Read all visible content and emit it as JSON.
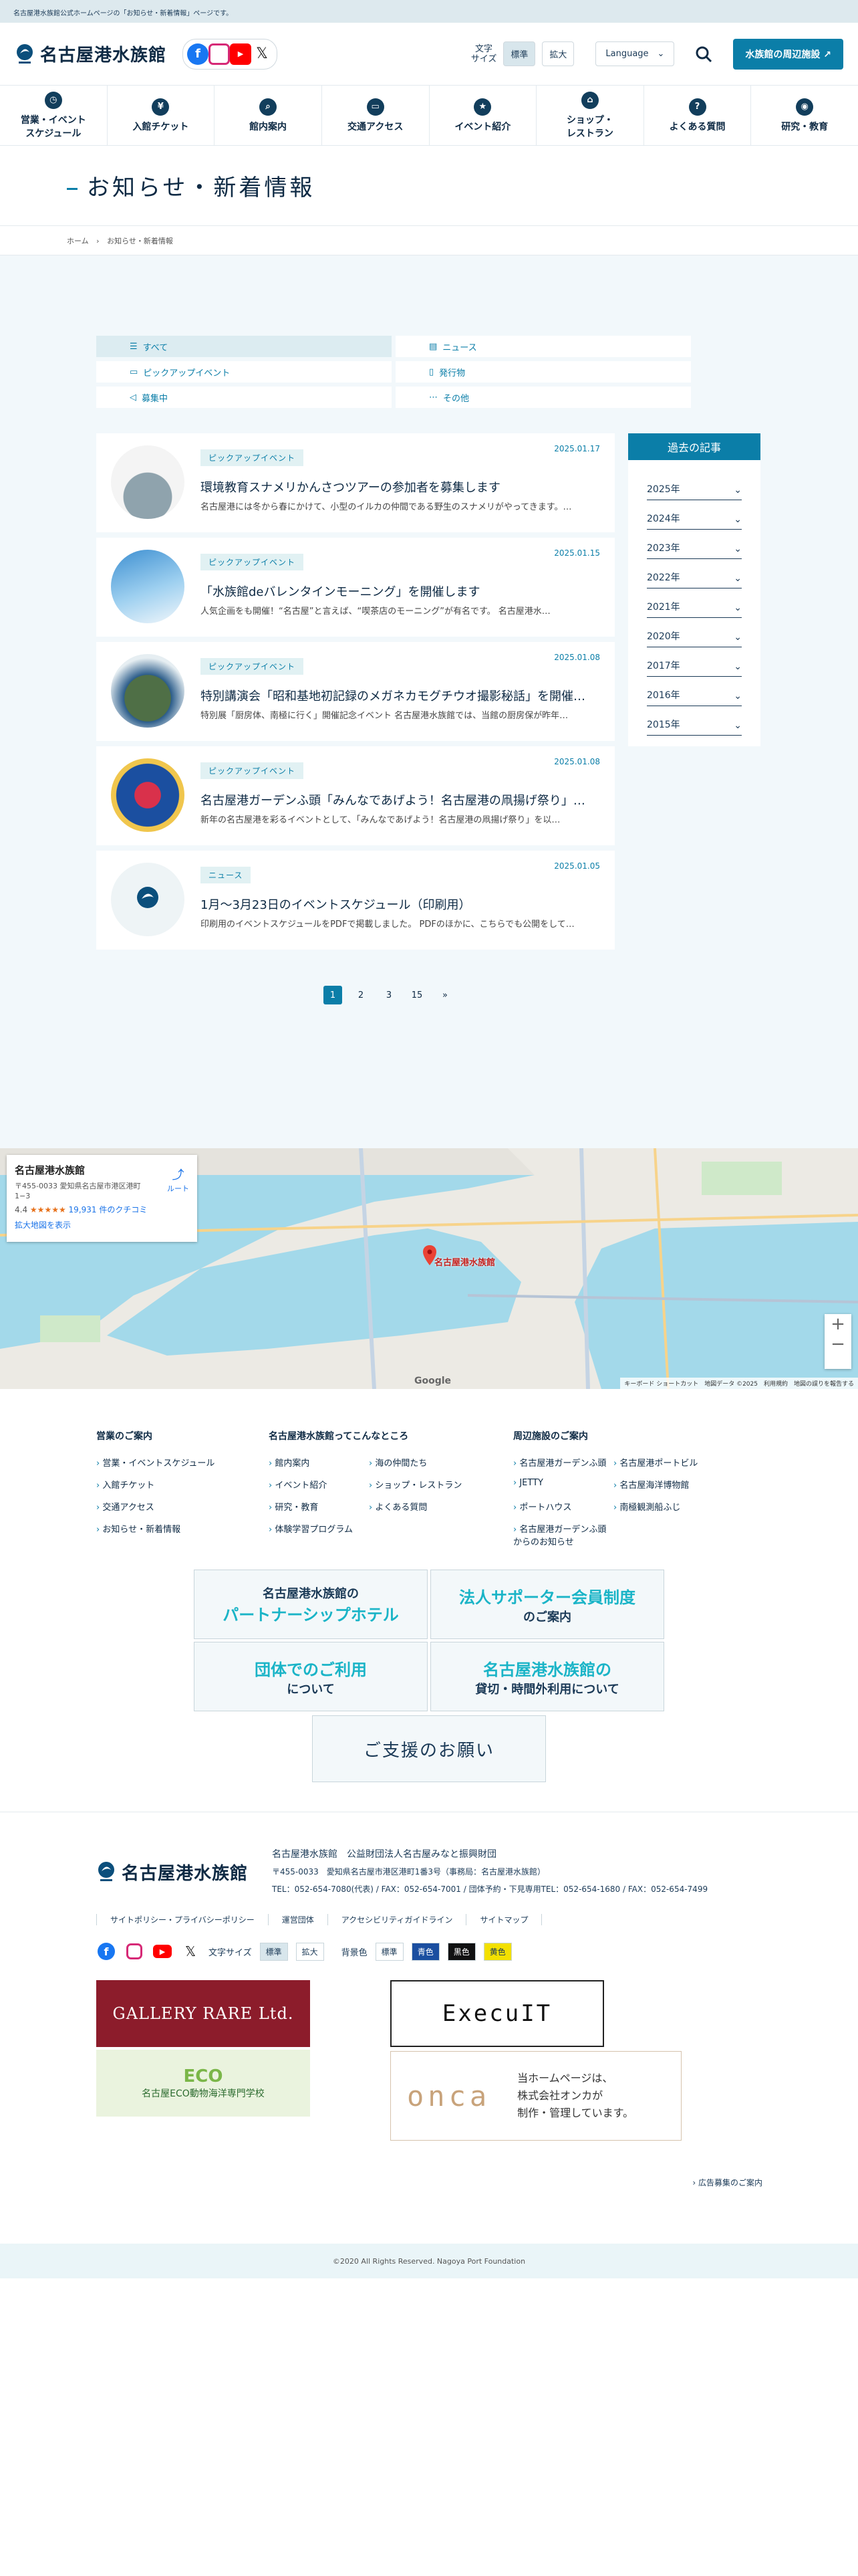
{
  "topbar": {
    "text": "名古屋港水族館公式ホームページの「お知らせ・新着情報」ページです。"
  },
  "header": {
    "logo_text": "名古屋港水族館",
    "font_size_label_1": "文字",
    "font_size_label_2": "サイズ",
    "font_size_standard": "標準",
    "font_size_large": "拡大",
    "language": "Language",
    "nearby_button": "水族館の周辺施設"
  },
  "gnav": [
    {
      "label1": "営業・イベント",
      "label2": "スケジュール",
      "icon": "clock-icon"
    },
    {
      "label1": "入館チケット",
      "label2": "",
      "icon": "ticket-icon"
    },
    {
      "label1": "館内案内",
      "label2": "",
      "icon": "map-icon"
    },
    {
      "label1": "交通アクセス",
      "label2": "",
      "icon": "bus-icon"
    },
    {
      "label1": "イベント紹介",
      "label2": "",
      "icon": "event-icon"
    },
    {
      "label1": "ショップ・",
      "label2": "レストラン",
      "icon": "shop-icon"
    },
    {
      "label1": "よくある質問",
      "label2": "",
      "icon": "question-icon"
    },
    {
      "label1": "研究・教育",
      "label2": "",
      "icon": "research-icon"
    }
  ],
  "page_title": "お知らせ・新着情報",
  "breadcrumb": {
    "home": "ホーム",
    "current": "お知らせ・新着情報"
  },
  "filters": [
    {
      "label": "すべて",
      "icon": "☰"
    },
    {
      "label": "ニュース",
      "icon": "▤"
    },
    {
      "label": "ピックアップイベント",
      "icon": "▭"
    },
    {
      "label": "発行物",
      "icon": "▯"
    },
    {
      "label": "募集中",
      "icon": "◁"
    },
    {
      "label": "その他",
      "icon": "⋯"
    }
  ],
  "articles": [
    {
      "tag": "ピックアップイベント",
      "date": "2025.01.17",
      "title": "環境教育スナメリかんさつツアーの参加者を募集します",
      "excerpt": "名古屋港には冬から春にかけて、小型のイルカの仲間である野生のスナメリがやってきます。…"
    },
    {
      "tag": "ピックアップイベント",
      "date": "2025.01.15",
      "title": "「水族館deバレンタインモーニング」を開催します",
      "excerpt": "人気企画をも開催！“名古屋”と言えば、“喫茶店のモーニング”が有名です。 名古屋港水…"
    },
    {
      "tag": "ピックアップイベント",
      "date": "2025.01.08",
      "title": "特別講演会「昭和基地初記録のメガネカモグチウオ撮影秘話」を開催…",
      "excerpt": "特別展「厨房体、南極に行く」開催記念イベント 名古屋港水族館では、当館の厨房保が昨年…"
    },
    {
      "tag": "ピックアップイベント",
      "date": "2025.01.08",
      "title": "名古屋港ガーデンふ頭「みんなであげよう！名古屋港の凧揚げ祭り」…",
      "excerpt": "新年の名古屋港を彩るイベントとして、「みんなであげよう！名古屋港の凧揚げ祭り」を以…"
    },
    {
      "tag": "ニュース",
      "date": "2025.01.05",
      "title": "1月〜3月23日のイベントスケジュール（印刷用）",
      "excerpt": "印刷用のイベントスケジュールをPDFで掲載しました。 PDFのほかに、こちらでも公開をして…"
    }
  ],
  "archive": {
    "title": "過去の記事",
    "years": [
      "2025年",
      "2024年",
      "2023年",
      "2022年",
      "2021年",
      "2020年",
      "2017年",
      "2016年",
      "2015年"
    ]
  },
  "pager": [
    "1",
    "2",
    "3",
    "15",
    "»"
  ],
  "map": {
    "place": "名古屋港水族館",
    "address": "〒455-0033 愛知県名古屋市港区港町 1−3",
    "rating": "4.4",
    "stars": "★★★★★",
    "reviews": "19,931 件のクチコミ",
    "expand": "拡大地図を表示",
    "route": "ルート",
    "pin_label": "名古屋港水族館",
    "footer": "キーボード ショートカット　地図データ ©2025　利用規約　地図の誤りを報告する",
    "google": "Google"
  },
  "footer_nav": [
    {
      "title": "営業のご案内",
      "items": [
        "営業・イベントスケジュール",
        "入館チケット",
        "交通アクセス",
        "お知らせ・新着情報"
      ]
    },
    {
      "title": "名古屋港水族館ってこんなところ",
      "items": [
        "館内案内",
        "海の仲間たち",
        "イベント紹介",
        "ショップ・レストラン",
        "研究・教育",
        "よくある質問",
        "体験学習プログラム"
      ]
    },
    {
      "title": "周辺施設のご案内",
      "items": [
        "名古屋港ガーデンふ頭",
        "名古屋港ポートビル",
        "JETTY",
        "名古屋海洋博物館",
        "ポートハウス",
        "南極観測船ふじ",
        "名古屋港ガーデンふ頭からのお知らせ"
      ]
    }
  ],
  "banners": [
    {
      "big": "名古屋港水族館の",
      "sub": "パートナーシップホテル"
    },
    {
      "big": "法人サポーター会員制度",
      "sub": "のご案内"
    },
    {
      "big": "団体でのご利用",
      "sub": "について"
    },
    {
      "big": "名古屋港水族館の",
      "sub": "貸切・時間外利用について"
    }
  ],
  "support": "ご支援のお願い",
  "footer": {
    "logo_text": "名古屋港水族館",
    "org": "名古屋港水族館　公益財団法人名古屋みなと振興財団",
    "address": "〒455-0033　愛知県名古屋市港区港町1番3号（事務局：名古屋港水族館）",
    "tel": "TEL：052-654-7080(代表) / FAX：052-654-7001 / 団体予約・下見専用TEL：052-654-1680 / FAX：052-654-7499",
    "links": [
      "サイトポリシー・プライバシーポリシー",
      "運営団体",
      "アクセシビリティガイドライン",
      "サイトマップ"
    ],
    "font_size": "文字サイズ",
    "standard": "標準",
    "large": "拡大",
    "bg_color": "背景色",
    "bg_standard": "標準",
    "bg_blue": "青色",
    "bg_black": "黒色",
    "bg_yellow": "黄色"
  },
  "ads": {
    "gallery": "GALLERY RARE Ltd.",
    "eco": "名古屋ECO動物海洋専門学校",
    "execuit": "ExecuIT",
    "onca_logo": "onca",
    "onca_text_1": "当ホームページは、",
    "onca_text_2": "株式会社オンカが",
    "onca_text_3": "制作・管理しています。",
    "note": "› 広告募集のご案内"
  },
  "copyright": "©2020 All Rights Reserved. Nagoya Port Foundation",
  "colors": {
    "accent": "#0b7ea8",
    "navy": "#0e2a44",
    "bg": "#f2f8fb"
  }
}
